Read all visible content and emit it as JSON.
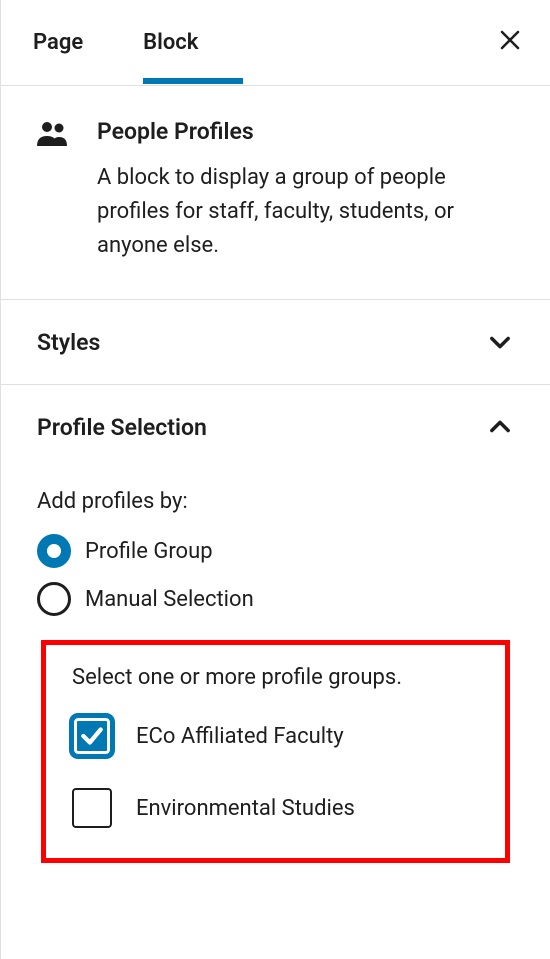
{
  "tabs": {
    "page": "Page",
    "block": "Block"
  },
  "block": {
    "title": "People Profiles",
    "description": "A block to display a group of people profiles for staff, faculty, students, or anyone else."
  },
  "sections": {
    "styles": {
      "title": "Styles",
      "open": false
    },
    "profile_selection": {
      "title": "Profile Selection",
      "open": true
    }
  },
  "profile_selection": {
    "field_label": "Add profiles by:",
    "options": [
      {
        "label": "Profile Group",
        "selected": true
      },
      {
        "label": "Manual Selection",
        "selected": false
      }
    ],
    "group_help": "Select one or more profile groups.",
    "groups": [
      {
        "label": "ECo Affiliated Faculty",
        "checked": true
      },
      {
        "label": "Environmental Studies",
        "checked": false
      }
    ]
  }
}
